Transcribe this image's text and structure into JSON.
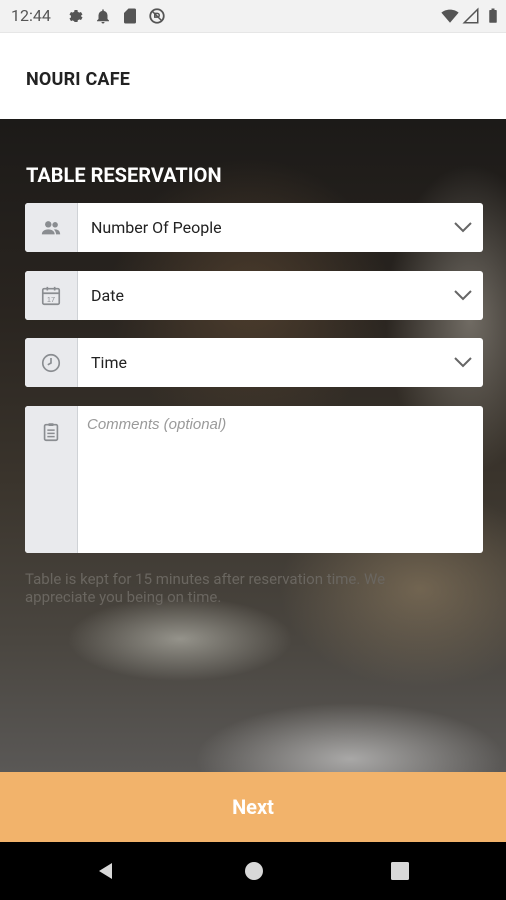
{
  "status_bar": {
    "time": "12:44",
    "left_icons": [
      "settings-icon",
      "notification-icon",
      "sd-card-icon",
      "do-not-disturb-icon"
    ],
    "right_icons": [
      "wifi-icon",
      "signal-icon",
      "battery-icon"
    ]
  },
  "header": {
    "title": "NOURI CAFE"
  },
  "form": {
    "title": "TABLE RESERVATION",
    "people": {
      "label": "Number Of People",
      "icon": "people-icon"
    },
    "date": {
      "label": "Date",
      "icon": "calendar-icon"
    },
    "time": {
      "label": "Time",
      "icon": "clock-icon"
    },
    "comments": {
      "placeholder": "Comments (optional)",
      "value": "",
      "icon": "clipboard-icon"
    },
    "note": "Table is kept for 15 minutes after reservation time. We appreciate you being on time."
  },
  "actions": {
    "next_label": "Next"
  },
  "colors": {
    "accent": "#f2b36b",
    "field_icon_bg": "#e9eaed"
  }
}
